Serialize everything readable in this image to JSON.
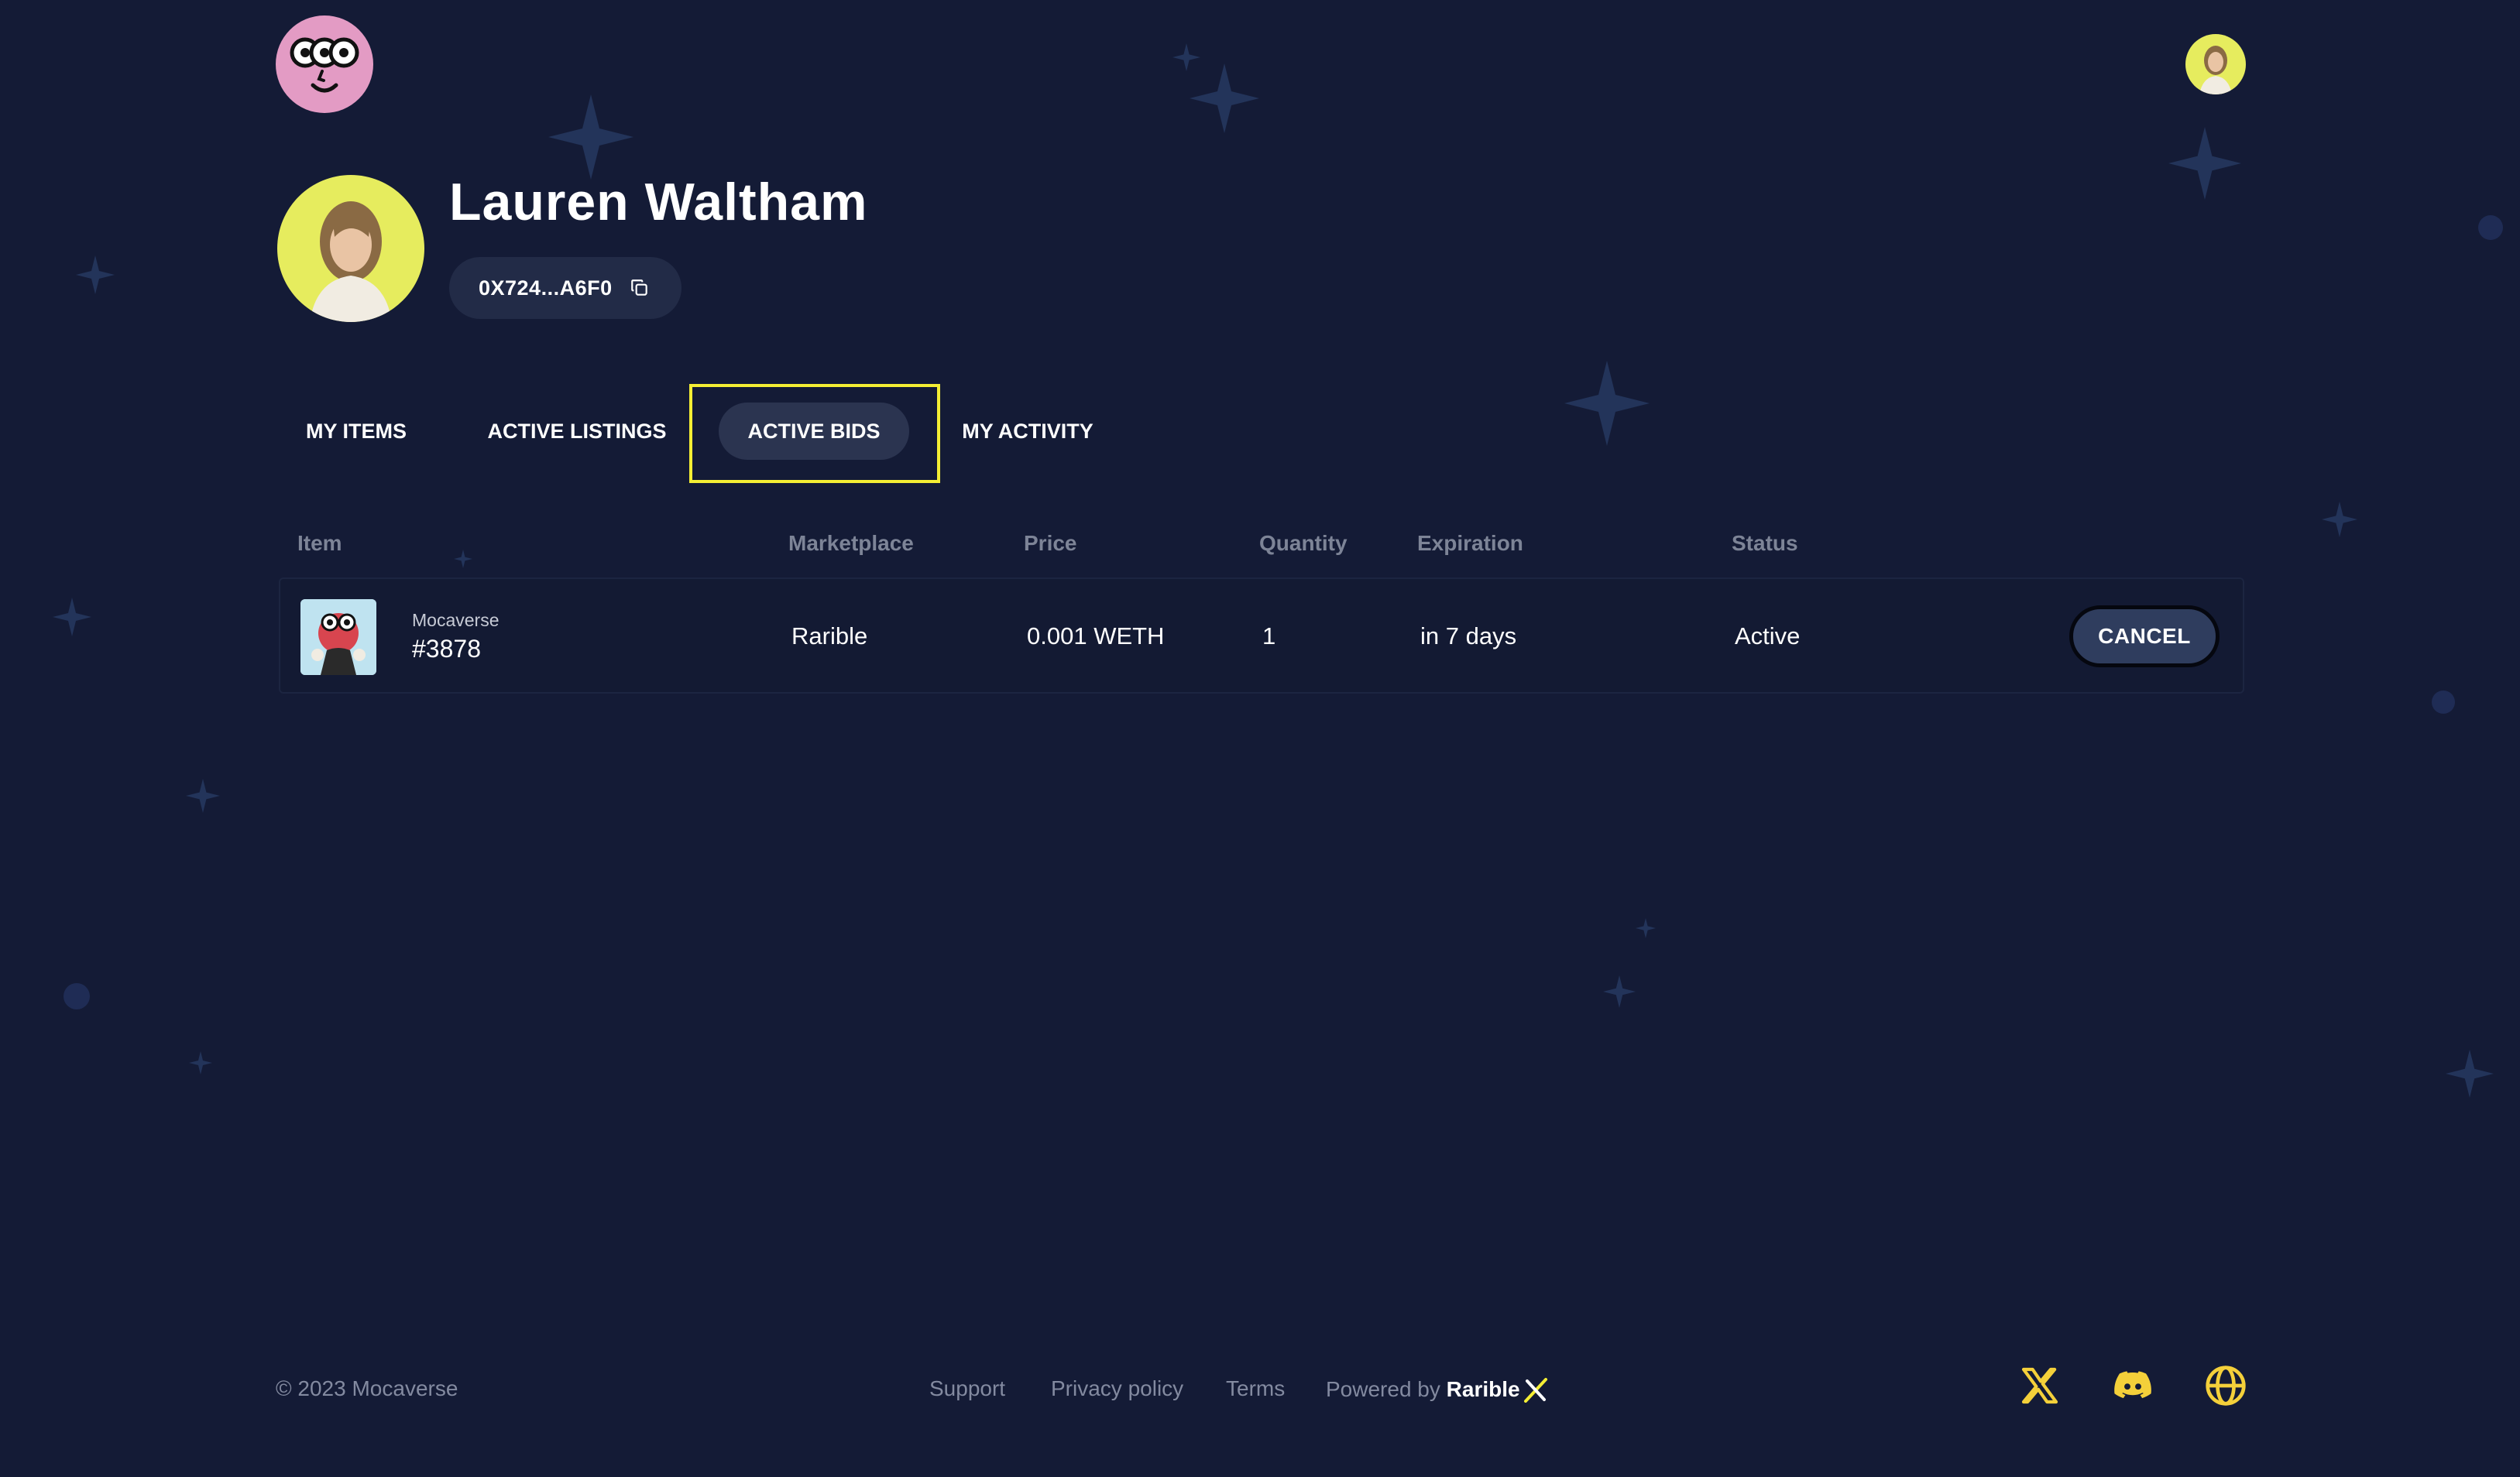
{
  "profile": {
    "name": "Lauren Waltham",
    "address": "0X724...A6F0"
  },
  "tabs": [
    {
      "label": "MY ITEMS"
    },
    {
      "label": "ACTIVE LISTINGS"
    },
    {
      "label": "ACTIVE BIDS"
    },
    {
      "label": "MY ACTIVITY"
    }
  ],
  "active_tab": "ACTIVE BIDS",
  "table": {
    "headers": [
      "Item",
      "Marketplace",
      "Price",
      "Quantity",
      "Expiration",
      "Status"
    ],
    "rows": [
      {
        "collection": "Mocaverse",
        "token": "#3878",
        "marketplace": "Rarible",
        "price": "0.001 WETH",
        "quantity": "1",
        "expiration": "in 7 days",
        "status": "Active",
        "action": "CANCEL"
      }
    ]
  },
  "footer": {
    "copyright": "© 2023 Mocaverse",
    "links": [
      "Support",
      "Privacy policy",
      "Terms"
    ],
    "powered_by": "Powered by",
    "brand": "Rarible"
  },
  "social_icons": [
    "x-icon",
    "discord-icon",
    "globe-icon"
  ],
  "colors": {
    "background": "#141b36",
    "highlight": "#f4ee34",
    "social": "#f4d03a",
    "avatar_bg": "#e6ec5e",
    "logo_bg": "#e39bc4"
  }
}
